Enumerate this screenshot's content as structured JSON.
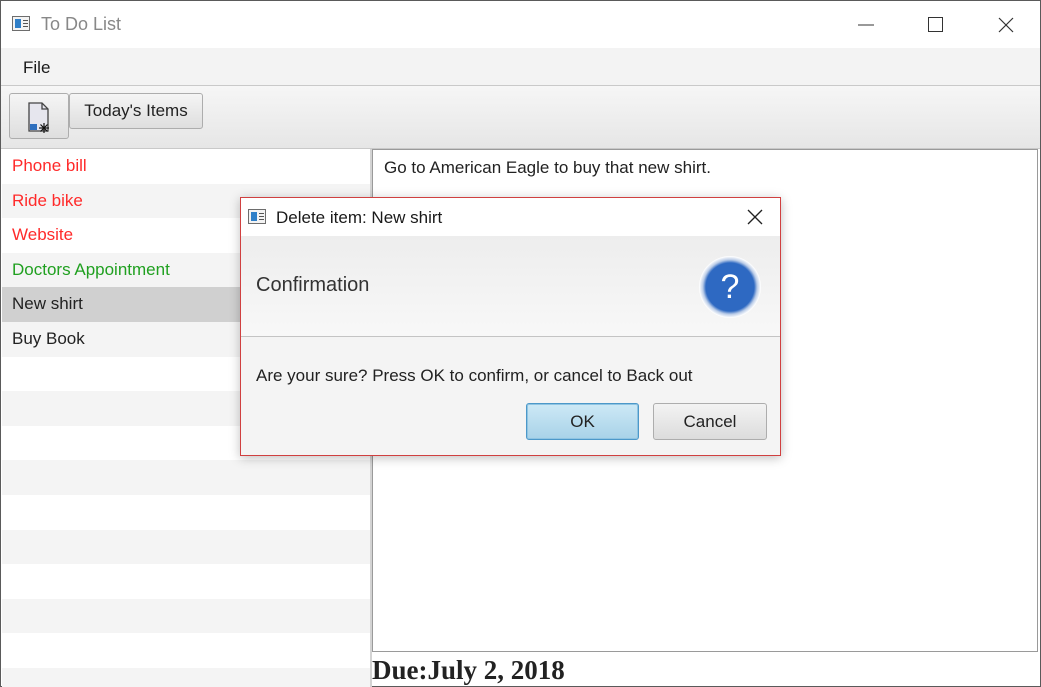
{
  "window": {
    "title": "To Do List",
    "controls": {
      "minimize": "minimize-icon",
      "maximize": "maximize-icon",
      "close": "close-icon"
    }
  },
  "menu": {
    "items": [
      {
        "label": "File"
      }
    ]
  },
  "toolbar": {
    "new_item_icon": "new-document-icon",
    "today_label": "Today's Items"
  },
  "todo_list": {
    "items": [
      {
        "label": "Phone bill",
        "color": "#ff2a2a"
      },
      {
        "label": "Ride bike",
        "color": "#ff2a2a"
      },
      {
        "label": "Website",
        "color": "#ff2a2a"
      },
      {
        "label": "Doctors Appointment",
        "color": "#20a020"
      },
      {
        "label": "New shirt",
        "color": "#222222",
        "selected": true
      },
      {
        "label": "Buy Book",
        "color": "#222222"
      }
    ]
  },
  "detail": {
    "text": "Go to American Eagle to buy that new shirt.",
    "due": "Due:July 2, 2018"
  },
  "dialog": {
    "title": "Delete item: New shirt",
    "header": "Confirmation",
    "icon": "question-icon",
    "content": "Are your sure? Press OK to confirm, or cancel to Back out",
    "ok_label": "OK",
    "cancel_label": "Cancel"
  },
  "colors": {
    "overdue": "#ff2a2a",
    "upcoming": "#20a020",
    "dialog_border": "#d04040",
    "ok_accent": "#a8d2e8"
  }
}
